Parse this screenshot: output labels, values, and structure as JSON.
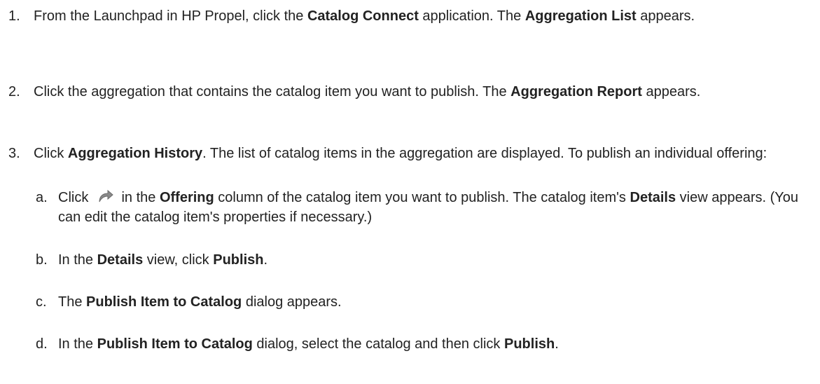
{
  "steps": [
    {
      "number": "1.",
      "parts": [
        {
          "t": "From the Launchpad in HP Propel, click the "
        },
        {
          "t": "Catalog Connect",
          "b": true
        },
        {
          "t": " application. The "
        },
        {
          "t": "Aggregation List",
          "b": true
        },
        {
          "t": " appears."
        }
      ]
    },
    {
      "number": "2.",
      "parts": [
        {
          "t": "Click the aggregation that contains the catalog item you want to publish. The "
        },
        {
          "t": "Aggregation Report",
          "b": true
        },
        {
          "t": " appears."
        }
      ]
    },
    {
      "number": "3.",
      "parts": [
        {
          "t": "Click "
        },
        {
          "t": "Aggregation History",
          "b": true
        },
        {
          "t": ". The list of catalog items in the aggregation are displayed. To publish an individual offering:"
        }
      ]
    }
  ],
  "substeps": [
    {
      "letter": "a.",
      "parts": [
        {
          "t": "Click "
        },
        {
          "icon": "redo-arrow-icon"
        },
        {
          "t": " in the "
        },
        {
          "t": "Offering",
          "b": true
        },
        {
          "t": " column of the catalog item you want to publish. The catalog item's "
        },
        {
          "t": "Details",
          "b": true
        },
        {
          "t": " view appears. (You can edit the catalog item's properties if necessary.)"
        }
      ]
    },
    {
      "letter": "b.",
      "parts": [
        {
          "t": "In the "
        },
        {
          "t": "Details",
          "b": true
        },
        {
          "t": " view, click "
        },
        {
          "t": "Publish",
          "b": true
        },
        {
          "t": "."
        }
      ]
    },
    {
      "letter": "c.",
      "parts": [
        {
          "t": "The "
        },
        {
          "t": "Publish Item to Catalog",
          "b": true
        },
        {
          "t": " dialog appears."
        }
      ]
    },
    {
      "letter": "d.",
      "parts": [
        {
          "t": "In the "
        },
        {
          "t": "Publish Item to Catalog",
          "b": true
        },
        {
          "t": " dialog, select the catalog and then click "
        },
        {
          "t": "Publish",
          "b": true
        },
        {
          "t": "."
        }
      ]
    }
  ]
}
